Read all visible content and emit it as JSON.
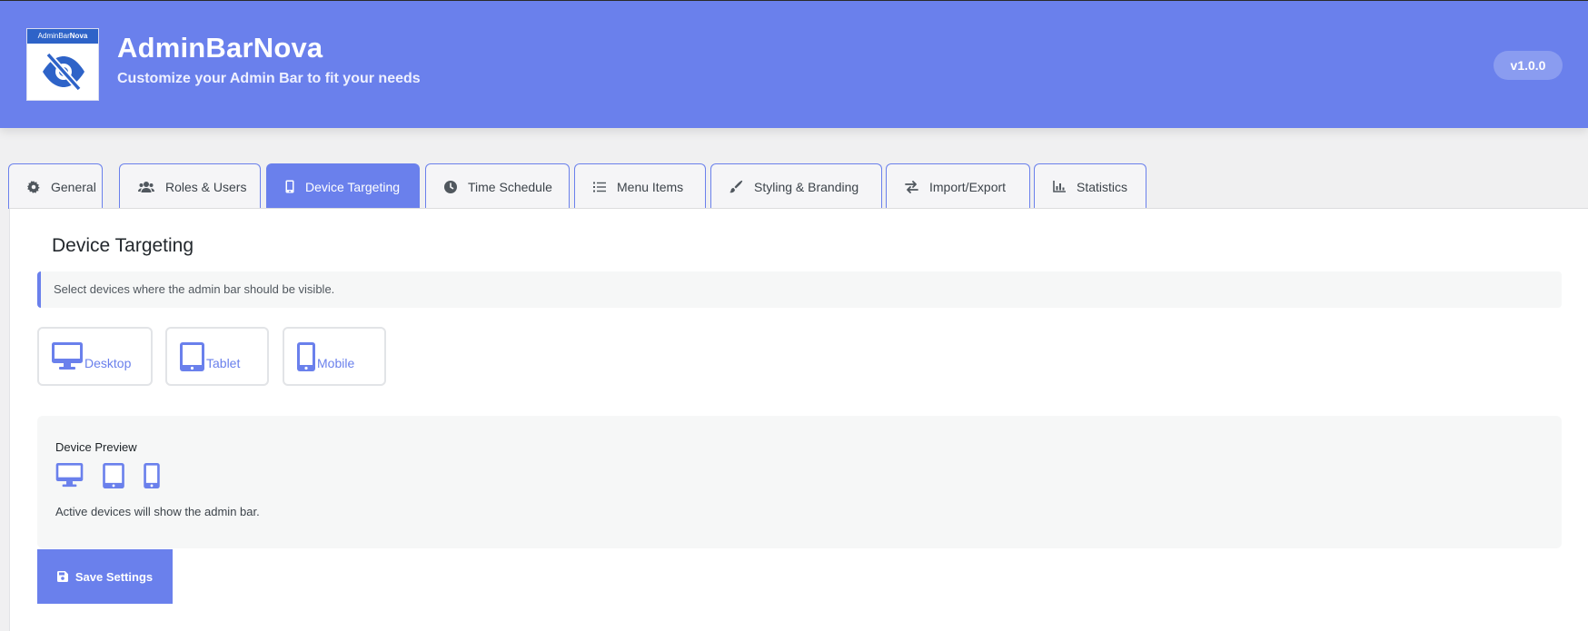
{
  "header": {
    "logo_text_regular": "AdminBar",
    "logo_text_bold": "Nova",
    "title": "AdminBarNova",
    "subtitle": "Customize your Admin Bar to fit your needs",
    "version": "v1.0.0",
    "background_color": "#6a80ec"
  },
  "tabs": [
    {
      "label": "General",
      "icon": "gear-icon"
    },
    {
      "label": "Roles & Users",
      "icon": "users-icon"
    },
    {
      "label": "Device Targeting",
      "icon": "mobile-icon",
      "active": true
    },
    {
      "label": "Time Schedule",
      "icon": "clock-icon"
    },
    {
      "label": "Menu Items",
      "icon": "list-icon"
    },
    {
      "label": "Styling & Branding",
      "icon": "paintbrush-icon"
    },
    {
      "label": "Import/Export",
      "icon": "exchange-icon"
    },
    {
      "label": "Statistics",
      "icon": "chart-icon"
    }
  ],
  "section": {
    "title": "Device Targeting",
    "notice": "Select devices where the admin bar should be visible."
  },
  "devices": [
    {
      "label": "Desktop",
      "icon": "desktop-icon"
    },
    {
      "label": "Tablet",
      "icon": "tablet-icon"
    },
    {
      "label": "Mobile",
      "icon": "mobile-icon"
    }
  ],
  "preview": {
    "title": "Device Preview",
    "note": "Active devices will show the admin bar."
  },
  "save_button": {
    "label": "Save Settings",
    "icon": "save-icon"
  },
  "colors": {
    "accent": "#6a80ec",
    "tab_inactive_bg": "#f5f5f7",
    "notice_bg": "#f6f7f7"
  }
}
